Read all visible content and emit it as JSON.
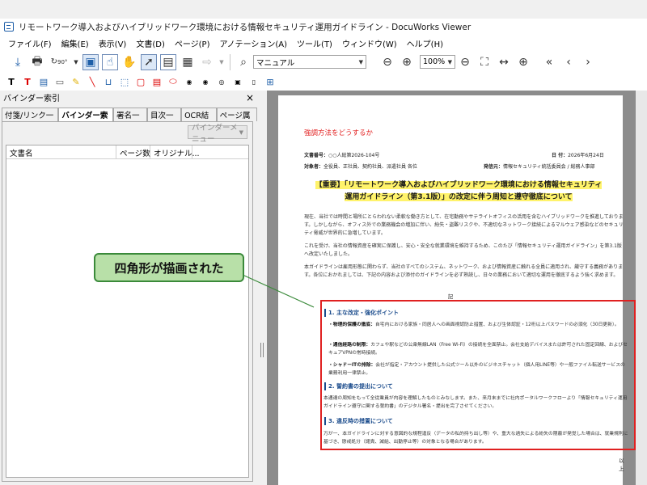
{
  "window": {
    "title": "リモートワーク導入およびハイブリッドワーク環境における情報セキュリティ運用ガイドライン - DocuWorks Viewer"
  },
  "menubar": [
    "ファイル(F)",
    "編集(E)",
    "表示(V)",
    "文書(D)",
    "ページ(P)",
    "アノテーション(A)",
    "ツール(T)",
    "ウィンドウ(W)",
    "ヘルプ(H)"
  ],
  "toolbar": {
    "manual_label": "マニュアル",
    "zoom_value": "100%",
    "rotate_label": "90°"
  },
  "left_panel": {
    "title": "バインダー索引",
    "tabs": [
      "付箋/リンク一覧",
      "バインダー索引",
      "署名一覧",
      "目次一覧",
      "OCR結果",
      "ページ属性"
    ],
    "active_tab": 1,
    "binder_menu_label": "バインダーメニュー",
    "columns": [
      "文書名",
      "ページ数",
      "オリジナル..."
    ]
  },
  "document": {
    "heading": "強調方法をどうするか",
    "doc_no_label": "文書番号：",
    "doc_no": "○○人総第2026-104号",
    "date_label": "日 付：",
    "date": "2026年6月24日",
    "target_label": "対象者：",
    "target": "全役員、正社員、契約社員、派遣社員 各位",
    "issuer_label": "発信元：",
    "issuer": "情報セキュリティ統括委員会 / 総務人事部",
    "title_line1": "【重要】「リモートワーク導入およびハイブリッドワーク環境における情報セキュリティ",
    "title_line2": "運用ガイドライン（第3.1版）」の改定に伴う周知と遵守徹底について",
    "para1": "現在、当社では時間と場所にとらわれない柔軟な働き方として、在宅勤務やサテライトオフィスの活用を含むハイブリッドワークを推進しております。しかしながら、オフィス外での業務機会の増加に伴い、紛失・盗難リスクや、不適切なネットワーク接続によるマルウェア感染などのセキュリティ脅威が世界的に急増しています。",
    "para2": "これを受け、当社の情報資産を確実に保護し、安心・安全な就業環境を維持するため、このたび「情報セキュリティ運用ガイドライン」を第3.1版へ改定いたしました。",
    "para3": "本ガイドラインは雇用形態に関わらず、当社のすべてのシステム、ネットワーク、および情報資産に触れる全員に適用され、厳守する義務があります。各位におかれましては、下記の内容および添付のガイドラインを必ず熟読し、日々の業務において適切な運用を徹底するよう強く求めます。",
    "ki": "記",
    "sec1_title": "1. 主な改定・強化ポイント",
    "sec1_i1_head": "・物理的保護の徹底：",
    "sec1_i1": "自宅内における家族・同居人への画面視認防止措置、および生体認証・12桁以上パスワードの必須化（30日更新）。",
    "sec1_i2_head": "・通信経路の制限：",
    "sec1_i2": "カフェや駅などの公衆無線LAN（Free Wi-Fi）の接続を全面禁止。会社支給デバイスまたは許可された固定回線、およびセキュアVPNの常時接続。",
    "sec1_i3_head": "・シャドーITの排除：",
    "sec1_i3": "会社が指定・アカウント提供した公式ツール以外のビジネスチャット（個人用LINE等）や一般ファイル転送サービスの業務利用一律禁止。",
    "sec2_title": "2. 誓約書の提出について",
    "sec2_p": "本通達の周知をもって全従業員が内容を理解したものとみなします。また、来月末までに社内ポータルワークフローより「情報セキュリティ運用ガイドライン遵守に関する誓約書」のデジタル署名・提出を完了させてください。",
    "sec3_title": "3. 違反時の措置について",
    "sec3_p": "万が一、本ガイドラインに対する意図的な規程違反（データの私的持ち出し等）や、重大な過失による紛失の隠蔽が発覚した場合は、就業規則に基づき、懲戒処分（譴責、減給、出勤停止等）の対象となる場合があります。",
    "ijo": "以上"
  },
  "callout": {
    "text": "四角形が描画された"
  },
  "colors": {
    "redbox": "#e02020",
    "callout_bg": "#b8e0a8",
    "callout_border": "#3a8a3a",
    "heading_red": "#e21c1c",
    "highlight": "#fff36b"
  }
}
